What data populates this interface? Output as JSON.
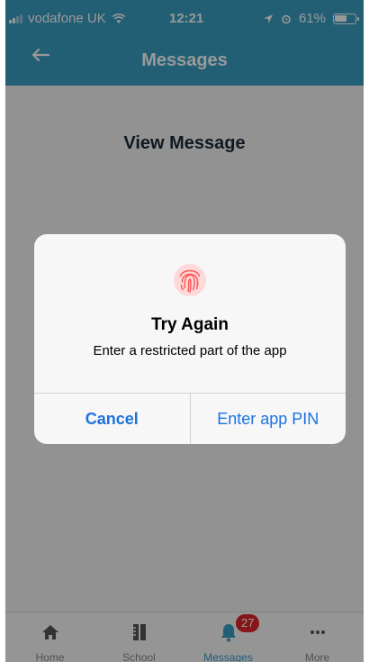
{
  "status_bar": {
    "carrier": "vodafone UK",
    "time": "12:21",
    "battery": "61%",
    "icons": [
      "signal-icon",
      "wifi-icon",
      "location-icon",
      "alarm-icon",
      "battery-icon"
    ]
  },
  "navbar": {
    "back_icon": "arrow-left-icon",
    "title": "Messages"
  },
  "content": {
    "title": "View Message"
  },
  "dialog": {
    "icon": "fingerprint-icon",
    "title": "Try Again",
    "message": "Enter a restricted part of the app",
    "cancel_label": "Cancel",
    "pin_label": "Enter app PIN"
  },
  "tabbar": {
    "tabs": [
      {
        "label": "Home",
        "icon": "home-icon"
      },
      {
        "label": "School",
        "icon": "school-icon"
      },
      {
        "label": "Messages",
        "icon": "bell-icon",
        "badge": "27",
        "active": true
      },
      {
        "label": "More",
        "icon": "more-icon"
      }
    ]
  },
  "colors": {
    "accent": "#3a9ec4",
    "badge": "#e0262a",
    "dialog_button": "#1a73e0",
    "fingerprint": "#ff5a5a"
  }
}
